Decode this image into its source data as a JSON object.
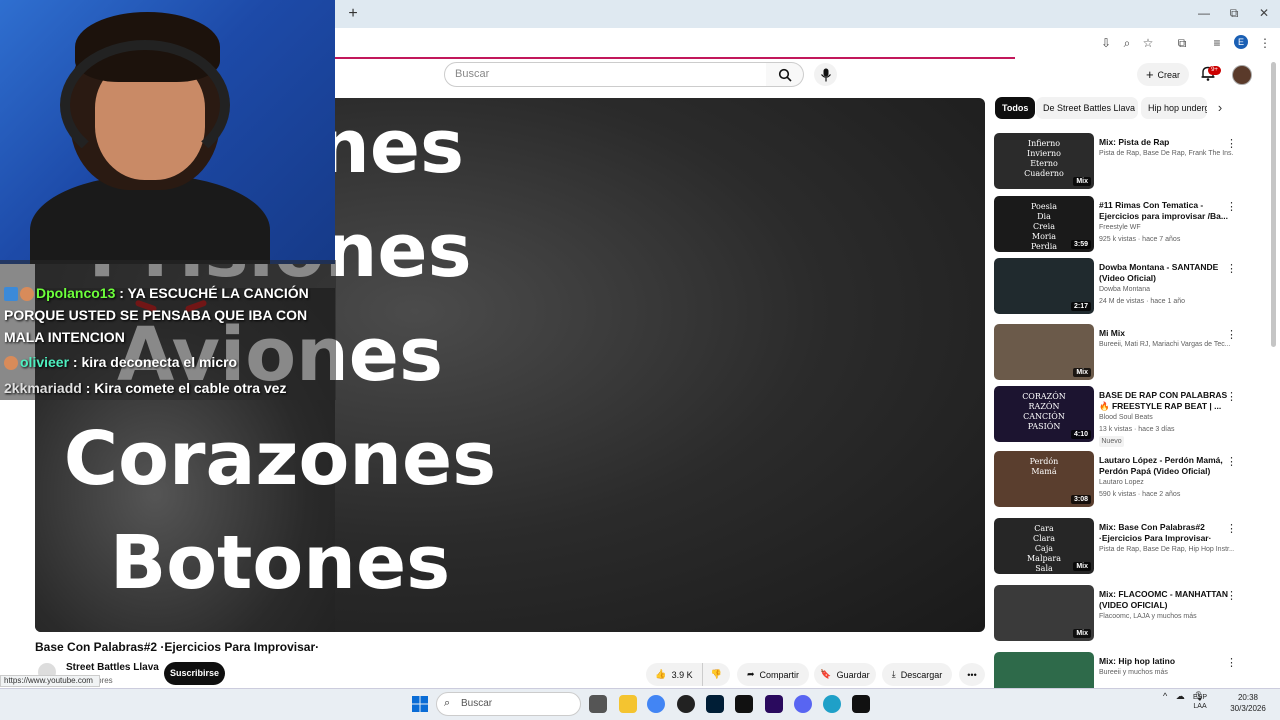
{
  "browser": {
    "new_tab": "+",
    "window_controls": {
      "minimize": "—",
      "restore": "⧉",
      "close": "✕"
    },
    "toolbar_icons": [
      "install-icon",
      "zoom-icon",
      "star-icon",
      "extensions-icon",
      "media-icon",
      "profile-icon",
      "menu-icon"
    ],
    "profile_letter": "E",
    "status_url": "https://www.youtube.com"
  },
  "header": {
    "search_placeholder": "Buscar",
    "create_label": "Crear",
    "notifications_badge": "9+"
  },
  "stream_overlay": {
    "chat": [
      {
        "user": "Dpolanco13",
        "text": ": YA ESCUCHÉ LA CANCIÓN PORQUE USTED SE PENSABA QUE IBA CON MALA INTENCION"
      },
      {
        "user": "olivieer",
        "text": ": kira deconecta el micro"
      },
      {
        "user": "2kkmariadd",
        "text": ": Kira comete el cable otra vez"
      }
    ]
  },
  "video": {
    "overlay_words": [
      "Acciones",
      "Prisiones",
      "Aviones",
      "Corazones",
      "Botones"
    ],
    "title": "Base Con Palabras#2 ·Ejercicios Para Improvisar·",
    "channel": "Street Battles Llava",
    "subscribers": "criptores",
    "subscribe_label": "Suscribirse",
    "likes": "3.9 K",
    "share_label": "Compartir",
    "save_label": "Guardar",
    "download_label": "Descargar",
    "more_label": "•••"
  },
  "chips": [
    "Todos",
    "De Street Battles Llava",
    "Hip hop undergr"
  ],
  "recommendations": [
    {
      "title": "Mix: Pista de Rap",
      "meta1": "Pista de Rap, Base De Rap, Frank The Ins...",
      "meta2": "",
      "badge": "Mix",
      "thumb_text": "Infierno\nInvierno\nEterno\nCuaderno",
      "thumb_color": "#2b2b2b"
    },
    {
      "title": "#11 Rimas Con Tematica -Ejercicios para improvisar /Ba...",
      "meta1": "Freestyle WF",
      "meta2": "925 k vistas · hace 7 años",
      "badge": "3:59",
      "thumb_text": "Poesia\nDia\nCreia\nMoria\nPerdia",
      "thumb_color": "#1a1a1a"
    },
    {
      "title": "Dowba Montana - SANTANDE (Video Oficial)",
      "meta1": "Dowba Montana",
      "meta2": "24 M de vistas · hace 1 año",
      "badge": "2:17",
      "thumb_text": "",
      "thumb_color": "#202a2e"
    },
    {
      "title": "Mi Mix",
      "meta1": "Bureeii, Mati RJ, Mariachi Vargas de Tec...",
      "meta2": "",
      "badge": "Mix",
      "thumb_text": "",
      "thumb_color": "#6b5a4a"
    },
    {
      "title": "BASE DE RAP CON PALABRAS 🔥 FREESTYLE RAP BEAT | ...",
      "meta1": "Blood Soul Beats",
      "meta2": "13 k vistas · hace 3 días",
      "badge": "4:10",
      "new": "Nuevo",
      "thumb_text": "CORAZÓN\nRAZÓN\nCANCIÓN\nPASIÓN",
      "thumb_color": "#1c1430"
    },
    {
      "title": "Lautaro López - Perdón Mamá, Perdón Papá (Video Oficial)",
      "meta1": "Lautaro Lopez",
      "meta2": "590 k vistas · hace 2 años",
      "badge": "3:08",
      "thumb_text": "Perdón\nMamá",
      "thumb_color": "#5a3e2e"
    },
    {
      "title": "Mix: Base Con Palabras#2 ·Ejercicios Para Improvisar·",
      "meta1": "Pista de Rap, Base De Rap, Hip Hop Instr...",
      "meta2": "",
      "badge": "Mix",
      "thumb_text": "Cara\nClara\nCaja\nMalpara\nSala",
      "thumb_color": "#262626"
    },
    {
      "title": "Mix: FLACOOMC - MANHATTAN (VIDEO OFICIAL)",
      "meta1": "Flacoomc, LAJA y muchos más",
      "meta2": "",
      "badge": "Mix",
      "thumb_text": "",
      "thumb_color": "#3a3a3a"
    },
    {
      "title": "Mix: Hip hop latino",
      "meta1": "Bureeii y muchos más",
      "meta2": "",
      "badge": "",
      "thumb_text": "",
      "thumb_color": "#2e6a4a"
    }
  ],
  "taskbar": {
    "search_label": "Buscar",
    "tray_lang": "ESP",
    "tray_layout": "LAA",
    "time": "20:38",
    "date": "30/3/2026"
  }
}
